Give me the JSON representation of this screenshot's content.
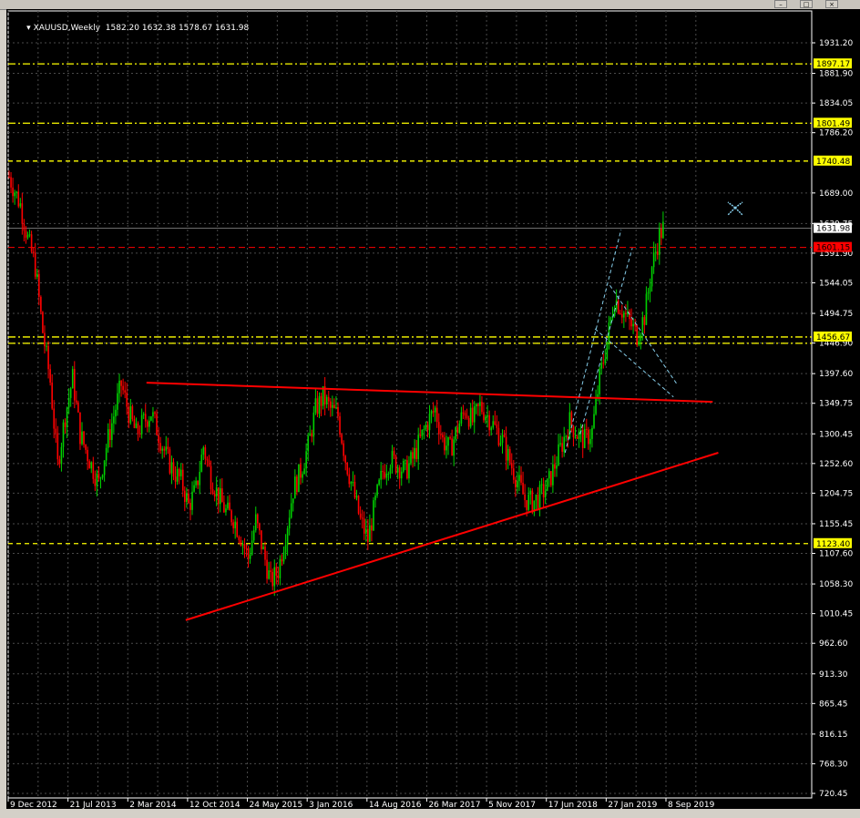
{
  "window": {
    "symbol": "XAUUSD,Weekly",
    "ohlc": "1582.20 1632.38 1578.67 1631.98",
    "minimize_glyph": "–",
    "maximize_glyph": "□",
    "close_glyph": "×"
  },
  "colors": {
    "background": "#000000",
    "grid": "#4a4a4a",
    "candle_up": "#00d000",
    "candle_down": "#ff0000",
    "axis_text": "#ffffff",
    "level_line": "#ffff00",
    "trend_line": "#ff0000",
    "channel_line": "#87ceeb",
    "current_price_label": "#ff0000"
  },
  "chart_data": {
    "type": "candlestick",
    "symbol": "XAUUSD",
    "timeframe": "Weekly",
    "ylim": [
      720.45,
      1960
    ],
    "y_ticks": [
      1931.2,
      1881.9,
      1834.05,
      1786.2,
      1689,
      1639.75,
      1591.9,
      1544.05,
      1494.75,
      1446.9,
      1397.6,
      1349.75,
      1300.45,
      1252.6,
      1204.75,
      1155.45,
      1107.6,
      1058.3,
      1010.45,
      962.6,
      913.3,
      865.45,
      816.15,
      768.3,
      720.45
    ],
    "y_tick_labels": [
      "1931.20",
      "1881.90",
      "1834.05",
      "1786.20",
      "1689.00",
      "1639.75",
      "1591.90",
      "1544.05",
      "1494.75",
      "1446.90",
      "1397.60",
      "1349.75",
      "1300.45",
      "1252.60",
      "1204.75",
      "1155.45",
      "1107.60",
      "1058.30",
      "1010.45",
      "962.60",
      "913.30",
      "865.45",
      "816.15",
      "768.30",
      "720.45"
    ],
    "x_tick_labels": [
      "9 Dec 2012",
      "21 Jul 2013",
      "2 Mar 2014",
      "12 Oct 2014",
      "24 May 2015",
      "3 Jan 2016",
      "14 Aug 2016",
      "26 Mar 2017",
      "5 Nov 2017",
      "17 Jun 2018",
      "27 Jan 2019",
      "8 Sep 2019"
    ],
    "x_tick_weeks": [
      0,
      32,
      64,
      96,
      128,
      160,
      192,
      224,
      256,
      288,
      320,
      352
    ],
    "x_range_weeks": [
      0,
      430
    ],
    "horizontal_levels": [
      {
        "price": 1897.17,
        "label": "1897.17",
        "style": "dashdot"
      },
      {
        "price": 1801.49,
        "label": "1801.49",
        "style": "dashdot"
      },
      {
        "price": 1740.48,
        "label": "1740.48",
        "style": "dashed"
      },
      {
        "price": 1456.67,
        "label": "1456.67",
        "style": "dashdot"
      },
      {
        "price": 1446.5,
        "label": "",
        "style": "dashdot"
      },
      {
        "price": 1123.4,
        "label": "1123.40",
        "style": "dashed"
      }
    ],
    "current_price": {
      "price": 1631.98,
      "label": "1631.98"
    },
    "red_level": {
      "price": 1601.15,
      "label": "1601.15"
    },
    "trendlines": [
      {
        "name": "resistance",
        "from": [
          74,
          1383
        ],
        "to": [
          377,
          1352
        ]
      },
      {
        "name": "support",
        "from": [
          95,
          1000
        ],
        "to": [
          380,
          1270
        ]
      }
    ],
    "channel_lines": [
      {
        "from": [
          298,
          1270
        ],
        "to": [
          328,
          1630
        ]
      },
      {
        "from": [
          306,
          1300
        ],
        "to": [
          334,
          1600
        ]
      },
      {
        "from": [
          314,
          1470
        ],
        "to": [
          356,
          1360
        ]
      },
      {
        "from": [
          322,
          1540
        ],
        "to": [
          358,
          1380
        ]
      }
    ],
    "price_path": [
      [
        0,
        1715
      ],
      [
        6,
        1670
      ],
      [
        10,
        1615
      ],
      [
        14,
        1570
      ],
      [
        18,
        1465
      ],
      [
        22,
        1385
      ],
      [
        26,
        1250
      ],
      [
        30,
        1330
      ],
      [
        34,
        1390
      ],
      [
        38,
        1300
      ],
      [
        44,
        1250
      ],
      [
        48,
        1220
      ],
      [
        52,
        1280
      ],
      [
        56,
        1330
      ],
      [
        60,
        1380
      ],
      [
        64,
        1335
      ],
      [
        68,
        1300
      ],
      [
        72,
        1320
      ],
      [
        76,
        1335
      ],
      [
        80,
        1300
      ],
      [
        84,
        1265
      ],
      [
        88,
        1240
      ],
      [
        92,
        1225
      ],
      [
        96,
        1185
      ],
      [
        100,
        1210
      ],
      [
        104,
        1280
      ],
      [
        108,
        1230
      ],
      [
        112,
        1200
      ],
      [
        116,
        1175
      ],
      [
        120,
        1165
      ],
      [
        124,
        1135
      ],
      [
        128,
        1100
      ],
      [
        132,
        1160
      ],
      [
        136,
        1110
      ],
      [
        140,
        1060
      ],
      [
        144,
        1080
      ],
      [
        148,
        1140
      ],
      [
        152,
        1210
      ],
      [
        156,
        1240
      ],
      [
        160,
        1280
      ],
      [
        164,
        1340
      ],
      [
        168,
        1360
      ],
      [
        172,
        1340
      ],
      [
        176,
        1330
      ],
      [
        180,
        1260
      ],
      [
        184,
        1210
      ],
      [
        188,
        1160
      ],
      [
        192,
        1130
      ],
      [
        196,
        1190
      ],
      [
        200,
        1240
      ],
      [
        204,
        1260
      ],
      [
        208,
        1250
      ],
      [
        212,
        1240
      ],
      [
        216,
        1260
      ],
      [
        220,
        1290
      ],
      [
        224,
        1320
      ],
      [
        228,
        1340
      ],
      [
        232,
        1290
      ],
      [
        236,
        1275
      ],
      [
        240,
        1310
      ],
      [
        244,
        1340
      ],
      [
        248,
        1320
      ],
      [
        252,
        1345
      ],
      [
        256,
        1330
      ],
      [
        260,
        1310
      ],
      [
        264,
        1290
      ],
      [
        268,
        1255
      ],
      [
        272,
        1225
      ],
      [
        276,
        1195
      ],
      [
        280,
        1190
      ],
      [
        284,
        1200
      ],
      [
        288,
        1215
      ],
      [
        292,
        1250
      ],
      [
        296,
        1285
      ],
      [
        300,
        1320
      ],
      [
        304,
        1300
      ],
      [
        308,
        1290
      ],
      [
        312,
        1305
      ],
      [
        316,
        1390
      ],
      [
        320,
        1450
      ],
      [
        324,
        1520
      ],
      [
        328,
        1500
      ],
      [
        332,
        1480
      ],
      [
        336,
        1460
      ],
      [
        340,
        1490
      ],
      [
        344,
        1570
      ],
      [
        348,
        1620
      ],
      [
        350,
        1632
      ]
    ]
  }
}
